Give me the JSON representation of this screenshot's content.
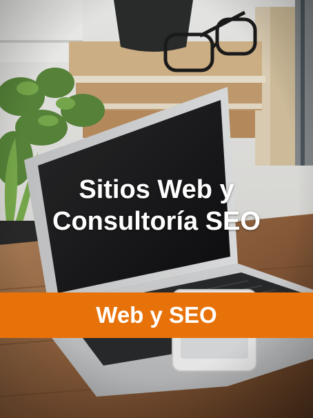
{
  "card": {
    "headline_line1": "Sitios Web y",
    "headline_line2": "Consultoría SEO",
    "banner_label": "Web y SEO"
  },
  "colors": {
    "banner": "#e8720a",
    "wood": "#9b6b45",
    "wall": "#e9e9e7"
  },
  "image": {
    "subject": "laptop-on-desk-photo"
  }
}
